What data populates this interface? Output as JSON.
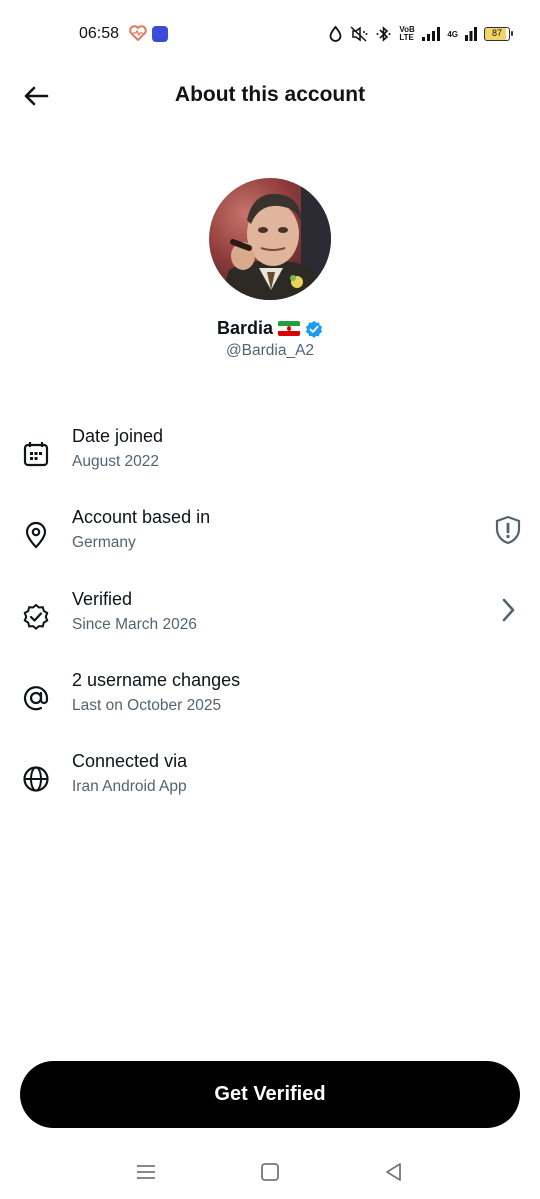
{
  "status_bar": {
    "time": "06:58",
    "network_label_1": "VoB LTE",
    "network_label_2": "4G",
    "battery": "87"
  },
  "header": {
    "title": "About this account",
    "back_icon": "arrow-left-icon"
  },
  "profile": {
    "display_name": "Bardia",
    "flag": "iran-flag",
    "handle": "@Bardia_A2",
    "verified": true
  },
  "info_items": [
    {
      "icon": "calendar-icon",
      "title": "Date joined",
      "subtitle": "August 2022"
    },
    {
      "icon": "location-pin-icon",
      "title": "Account based in",
      "subtitle": "Germany",
      "trailing": "shield-alert-icon"
    },
    {
      "icon": "verified-seal-icon",
      "title": "Verified",
      "subtitle": "Since March 2026",
      "trailing": "chevron-right-icon"
    },
    {
      "icon": "at-sign-icon",
      "title": "2 username changes",
      "subtitle": "Last on October 2025"
    },
    {
      "icon": "globe-icon",
      "title": "Connected via",
      "subtitle": "Iran Android App"
    }
  ],
  "cta": {
    "label": "Get Verified"
  },
  "colors": {
    "primary_text": "#0f1419",
    "secondary_text": "#536471",
    "button_bg": "#000000",
    "verified_blue": "#1d9bf0"
  }
}
